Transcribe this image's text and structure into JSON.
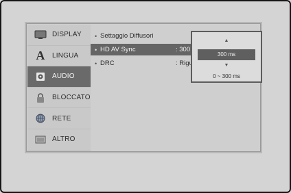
{
  "sidebar": {
    "items": [
      {
        "label": "DISPLAY",
        "icon": "monitor-icon",
        "selected": false
      },
      {
        "label": "LINGUA",
        "icon": "letter-a-icon",
        "selected": false
      },
      {
        "label": "AUDIO",
        "icon": "speaker-icon",
        "selected": true
      },
      {
        "label": "BLOCCATO",
        "icon": "padlock-icon",
        "selected": false
      },
      {
        "label": "RETE",
        "icon": "globe-icon",
        "selected": false
      },
      {
        "label": "ALTRO",
        "icon": "settings-icon",
        "selected": false
      }
    ]
  },
  "content": {
    "rows": [
      {
        "label": "Settaggio Diffusori",
        "value": ""
      },
      {
        "label": "HD AV Sync",
        "value": ": 300 m",
        "selected": true
      },
      {
        "label": "DRC",
        "value": ": Rigu"
      }
    ],
    "bullet": "•"
  },
  "popup": {
    "up_arrow": "▲",
    "down_arrow": "▼",
    "value": "300 ms",
    "range": "0 ~ 300 ms"
  },
  "letter_a": "A"
}
